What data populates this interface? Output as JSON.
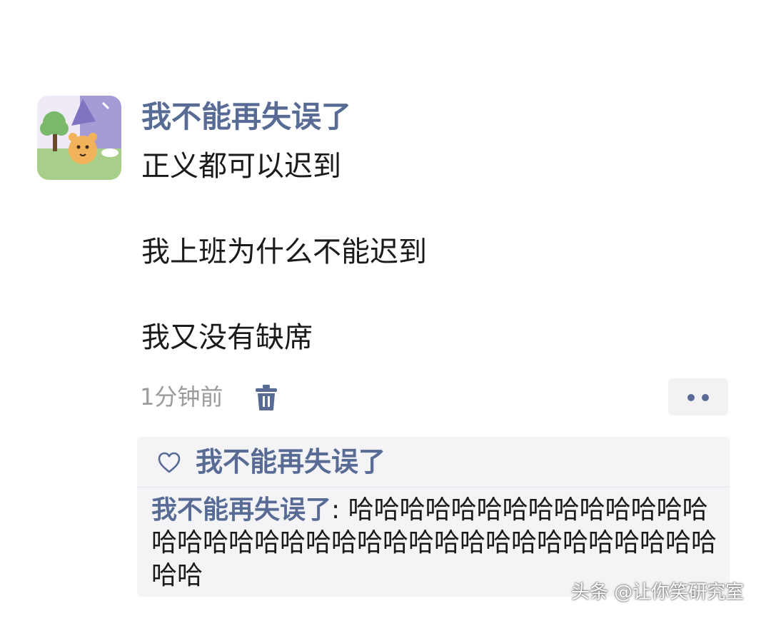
{
  "post": {
    "username": "我不能再失误了",
    "lines": [
      "正义都可以迟到",
      "我上班为什么不能迟到",
      "我又没有缺席"
    ],
    "time": "1分钟前",
    "icons": {
      "avatar": "cartoon-bear-avatar",
      "delete": "trash-icon",
      "more": "more-dots-icon"
    }
  },
  "interactions": {
    "likes": {
      "icon": "heart-icon",
      "names": "我不能再失误了"
    },
    "comments": [
      {
        "author": "我不能再失误了",
        "separator": ": ",
        "text": "哈哈哈哈哈哈哈哈哈哈哈哈哈哈哈哈哈哈哈哈哈哈哈哈哈哈哈哈哈哈哈哈哈哈哈哈哈哈"
      }
    ]
  },
  "watermark": "头条 @让你笑研究室",
  "colors": {
    "name_link": "#576b95",
    "body_text": "#1a1a1a",
    "meta_text": "#9b9b9b",
    "comment_bg": "#f4f4f6"
  }
}
